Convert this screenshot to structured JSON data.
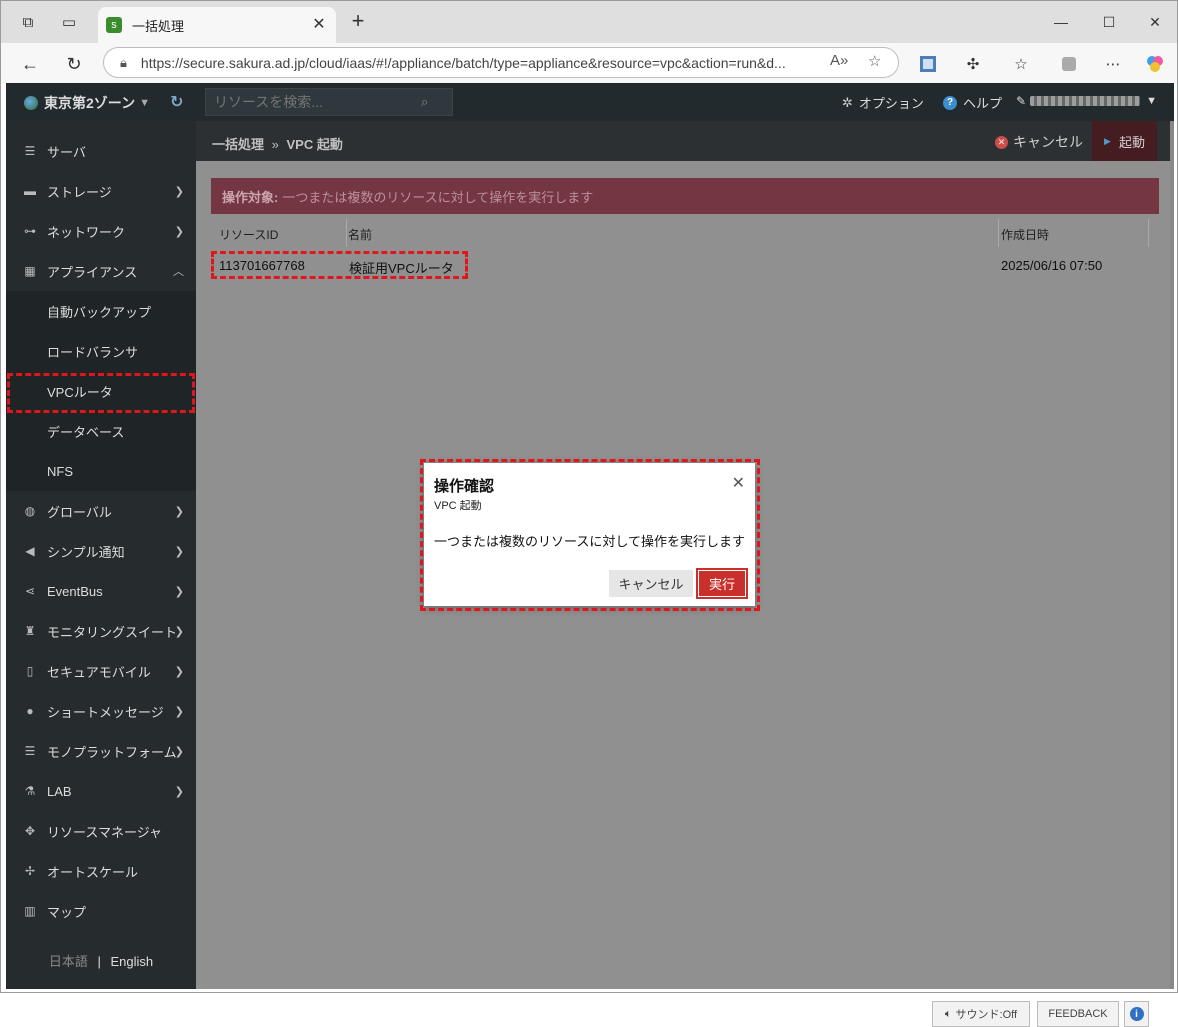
{
  "browser": {
    "tab_title": "一括処理",
    "url": "https://secure.sakura.ad.jp/cloud/iaas/#!/appliance/batch/type=appliance&resource=vpc&action=run&d..."
  },
  "topnav": {
    "zone": "東京第2ゾーン",
    "search_placeholder": "リソースを検索...",
    "option": "オプション",
    "help": "ヘルプ"
  },
  "sidebar": {
    "items": [
      {
        "label": "サーバ",
        "icon": "server-icon"
      },
      {
        "label": "ストレージ",
        "icon": "storage-icon"
      },
      {
        "label": "ネットワーク",
        "icon": "network-icon"
      },
      {
        "label": "アプライアンス",
        "icon": "appliance-icon"
      }
    ],
    "sub_items": [
      "自動バックアップ",
      "ロードバランサ",
      "VPCルータ",
      "データベース",
      "NFS"
    ],
    "items2": [
      {
        "label": "グローバル",
        "icon": "globe-icon"
      },
      {
        "label": "シンプル通知",
        "icon": "megaphone-icon"
      },
      {
        "label": "EventBus",
        "icon": "share-icon"
      },
      {
        "label": "モニタリングスイート",
        "icon": "binoculars-icon"
      },
      {
        "label": "セキュアモバイル",
        "icon": "mobile-icon"
      },
      {
        "label": "ショートメッセージ",
        "icon": "chat-icon"
      },
      {
        "label": "モノプラットフォーム",
        "icon": "list-icon"
      },
      {
        "label": "LAB",
        "icon": "flask-icon"
      },
      {
        "label": "リソースマネージャ",
        "icon": "puzzle-icon"
      },
      {
        "label": "オートスケール",
        "icon": "arrows-icon"
      },
      {
        "label": "マップ",
        "icon": "map-icon"
      }
    ],
    "lang_ja": "日本語",
    "lang_sep": "|",
    "lang_en": "English"
  },
  "main": {
    "breadcrumb_parent": "一括処理",
    "breadcrumb_sep": "»",
    "breadcrumb_current": "VPC 起動",
    "cancel": "キャンセル",
    "start": "起動",
    "alert_label": "操作対象:",
    "alert_text": "一つまたは複数のリソースに対して操作を実行します",
    "table": {
      "headers": [
        "リソースID",
        "名前",
        "作成日時"
      ],
      "rows": [
        {
          "id": "113701667768",
          "name": "検証用VPCルータ",
          "created": "2025/06/16 07:50"
        }
      ]
    }
  },
  "modal": {
    "title": "操作確認",
    "subtitle": "VPC 起動",
    "message": "一つまたは複数のリソースに対して操作を実行します",
    "cancel": "キャンセル",
    "run": "実行"
  },
  "footer": {
    "sound": "サウンド:Off",
    "feedback": "FEEDBACK"
  }
}
